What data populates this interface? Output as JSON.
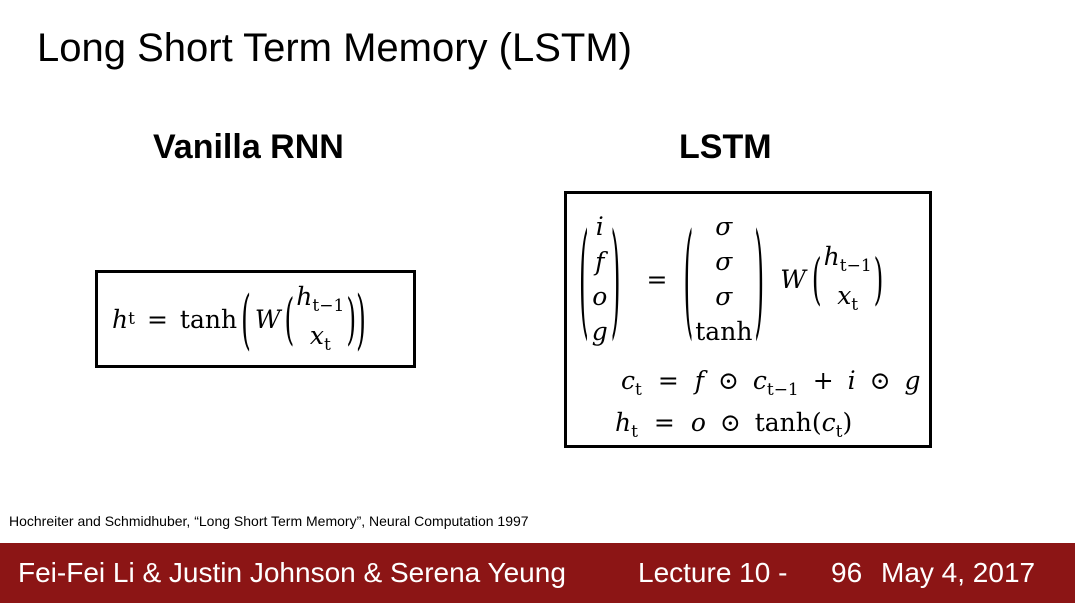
{
  "slide": {
    "title": "Long Short Term Memory (LSTM)",
    "left_heading": "Vanilla RNN",
    "right_heading": "LSTM",
    "citation": "Hochreiter and Schmidhuber, “Long Short Term Memory”, Neural Computation 1997"
  },
  "rnn_equation": {
    "lhs": "h",
    "lhs_sub": "t",
    "eq": "=",
    "func": "tanh",
    "weight": "W",
    "vec_top": "h",
    "vec_top_sub": "t−1",
    "vec_bottom": "x",
    "vec_bottom_sub": "t"
  },
  "lstm_equation": {
    "gates": [
      "i",
      "f",
      "o",
      "g"
    ],
    "eq": "=",
    "activations": [
      "σ",
      "σ",
      "σ",
      "tanh"
    ],
    "weight": "W",
    "vec_top": "h",
    "vec_top_sub": "t−1",
    "vec_bottom": "x",
    "vec_bottom_sub": "t",
    "cell_line": {
      "lhs": "c",
      "lhs_sub": "t",
      "eq": "=",
      "a": "f",
      "op1": "⊙",
      "b": "c",
      "b_sub": "t−1",
      "plus": "+",
      "c": "i",
      "op2": "⊙",
      "d": "g"
    },
    "hidden_line": {
      "lhs": "h",
      "lhs_sub": "t",
      "eq": "=",
      "a": "o",
      "op": "⊙",
      "func": "tanh",
      "open": "(",
      "arg": "c",
      "arg_sub": "t",
      "close": ")"
    }
  },
  "footer": {
    "authors": "Fei-Fei Li & Justin Johnson & Serena Yeung",
    "lecture": "Lecture 10 -",
    "page": "96",
    "date": "May 4, 2017",
    "background_color": "#8c1515"
  }
}
